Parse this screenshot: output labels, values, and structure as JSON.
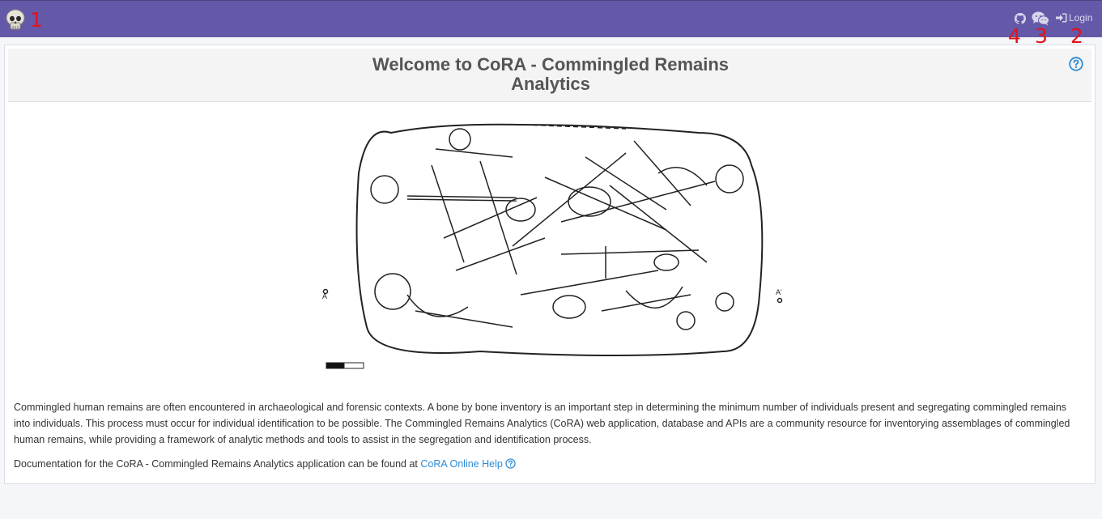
{
  "navbar": {
    "background": "#6459a9",
    "logo_icon": "skull-icon",
    "github_icon": "github-icon",
    "chat_icon": "wechat-icon",
    "login_icon": "sign-in-icon",
    "login_label": "Login",
    "annotations": [
      "1",
      "2",
      "3",
      "4"
    ]
  },
  "header": {
    "title_line1": "Welcome to CoRA - Commingled Remains",
    "title_line2": "Analytics",
    "help_icon": "question-circle-icon"
  },
  "illustration": {
    "name": "commingled-burial-drawing"
  },
  "body": {
    "description": "Commingled human remains are often encountered in archaeological and forensic contexts. A bone by bone inventory is an important step in determining the minimum number of individuals present and segregating commingled remains into individuals. This process must occur for individual identification to be possible. The Commingled Remains Analytics (CoRA) web application, database and APIs are a community resource for inventorying assemblages of commingled human remains, while providing a framework of analytic methods and tools to assist in the segregation and identification process.",
    "doc_prefix": "Documentation for the CoRA - Commingled Remains Analytics application can be found at ",
    "doc_link": "CoRA Online Help",
    "link_color": "#2c8bd5"
  }
}
